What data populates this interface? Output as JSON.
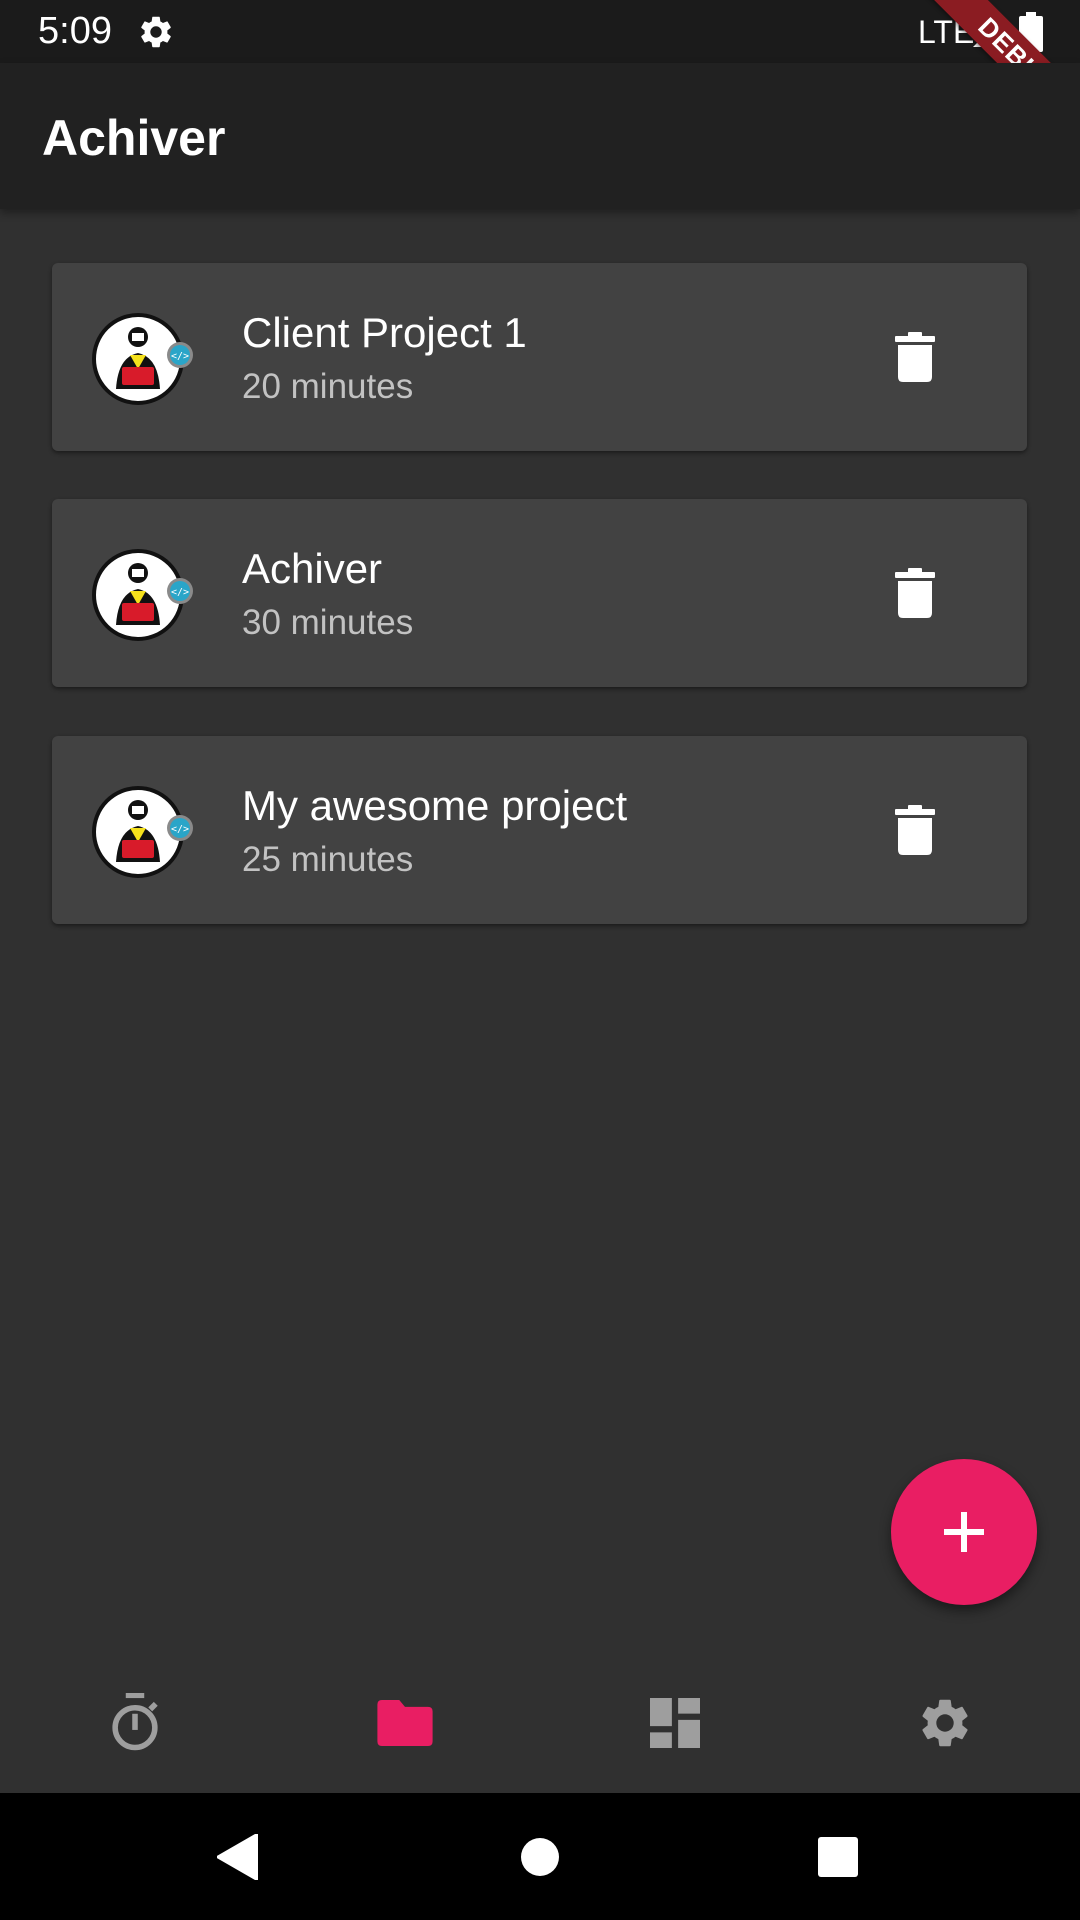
{
  "status_bar": {
    "time": "5:09",
    "network": "LTE",
    "icons": [
      "gear-icon",
      "signal-icon",
      "battery-icon"
    ]
  },
  "debug_banner": "DEBUG",
  "app_bar": {
    "title": "Achiver"
  },
  "projects": [
    {
      "name": "Client Project 1",
      "duration": "20 minutes",
      "icon": "developer-avatar"
    },
    {
      "name": "Achiver",
      "duration": "30 minutes",
      "icon": "developer-avatar"
    },
    {
      "name": "My awesome project",
      "duration": "25 minutes",
      "icon": "developer-avatar"
    }
  ],
  "fab": {
    "icon": "plus-icon"
  },
  "bottom_nav": {
    "items": [
      {
        "icon": "timer-icon",
        "active": false
      },
      {
        "icon": "folder-icon",
        "active": true
      },
      {
        "icon": "dashboard-icon",
        "active": false
      },
      {
        "icon": "settings-icon",
        "active": false
      }
    ]
  },
  "system_nav": {
    "icons": [
      "back-icon",
      "home-icon",
      "recents-icon"
    ]
  },
  "colors": {
    "accent": "#e91e63",
    "background": "#303030",
    "card": "#424242",
    "app_bar": "#212121",
    "nav_inactive": "#9e9e9e",
    "debug_ribbon": "#8b1c22"
  }
}
